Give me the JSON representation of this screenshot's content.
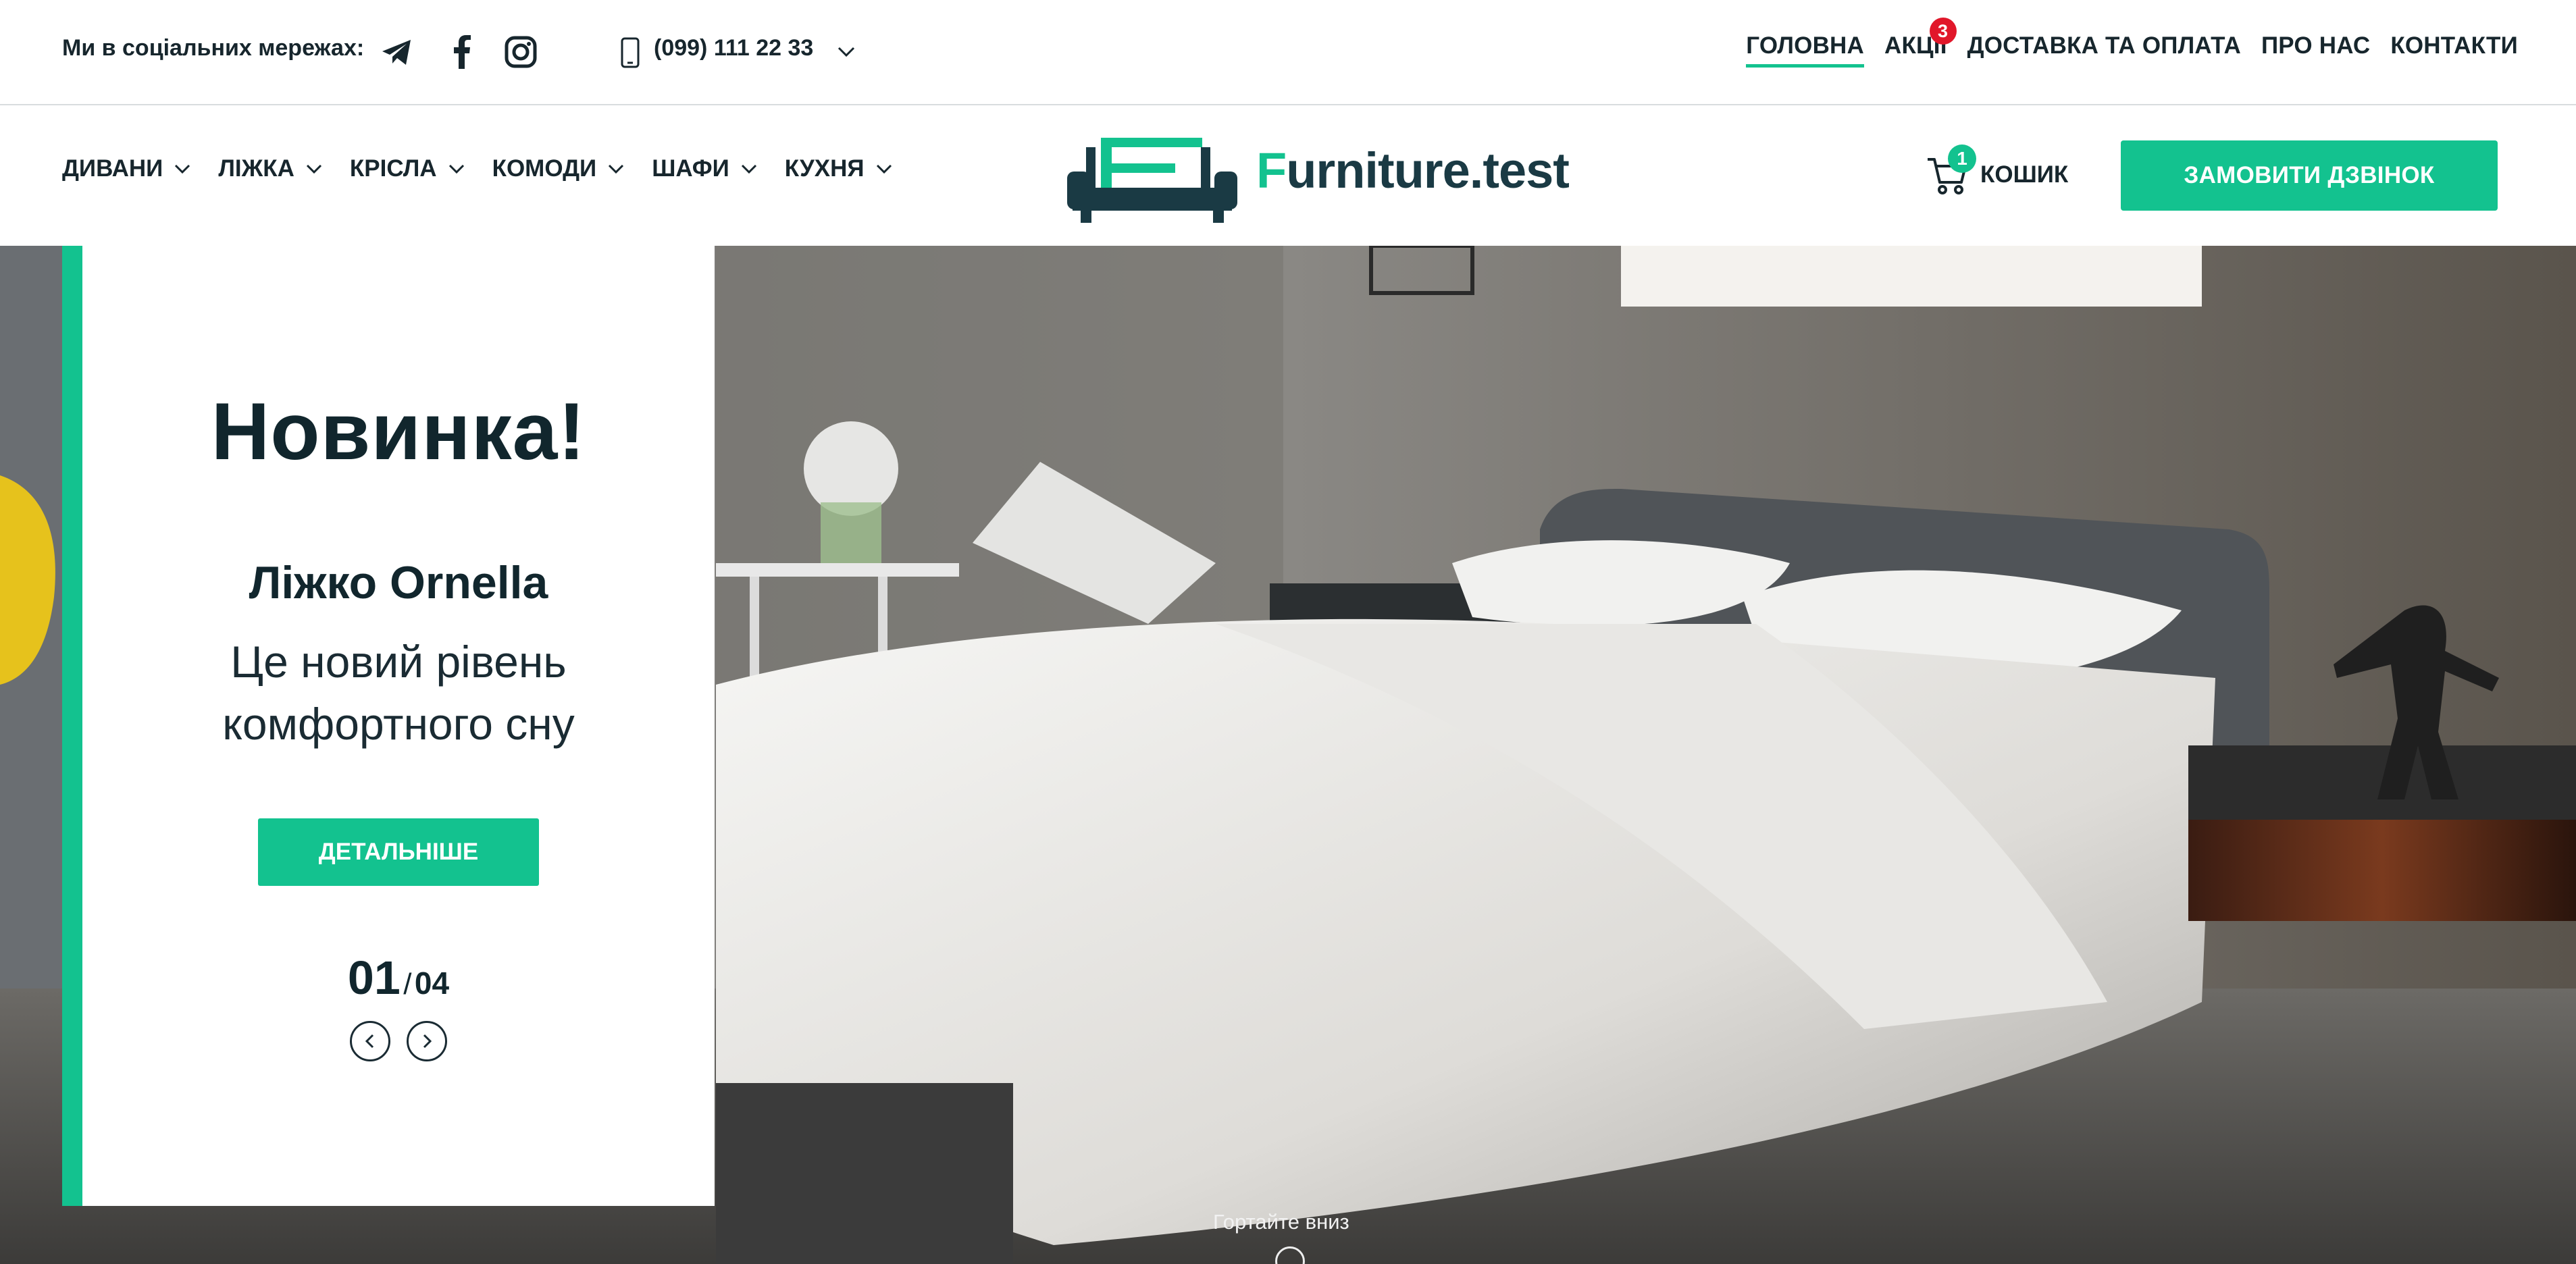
{
  "topbar": {
    "social_label": "Ми в соціальних мережах:",
    "social_icons": [
      "telegram-icon",
      "facebook-icon",
      "instagram-icon"
    ],
    "phone": "(099) 111 22 33",
    "nav": [
      {
        "label": "ГОЛОВНА",
        "active": true
      },
      {
        "label": "АКЦІЇ",
        "badge": "3"
      },
      {
        "label": "ДОСТАВКА ТА ОПЛАТА"
      },
      {
        "label": "ПРО НАС"
      },
      {
        "label": "КОНТАКТИ"
      }
    ]
  },
  "header": {
    "categories": [
      {
        "label": "ДИВАНИ"
      },
      {
        "label": "ЛІЖКА"
      },
      {
        "label": "КРІСЛА"
      },
      {
        "label": "КОМОДИ"
      },
      {
        "label": "ШАФИ"
      },
      {
        "label": "КУХНЯ"
      }
    ],
    "logo": {
      "first_letter": "F",
      "rest": "urniture.test"
    },
    "cart": {
      "label": "КОШИК",
      "count": "1"
    },
    "call_button": "ЗАМОВИТИ ДЗВІНОК"
  },
  "hero": {
    "title": "Новинка!",
    "product": "Ліжко Ornella",
    "description": "Це новий рівень комфортного сну",
    "button": "ДЕТАЛЬНІШЕ",
    "slide_current": "01",
    "slide_separator": "/",
    "slide_total": "04",
    "scroll_hint": "Гортайте вниз"
  },
  "colors": {
    "accent": "#13c28f",
    "dark": "#17262d",
    "badge_red": "#e1172a"
  }
}
